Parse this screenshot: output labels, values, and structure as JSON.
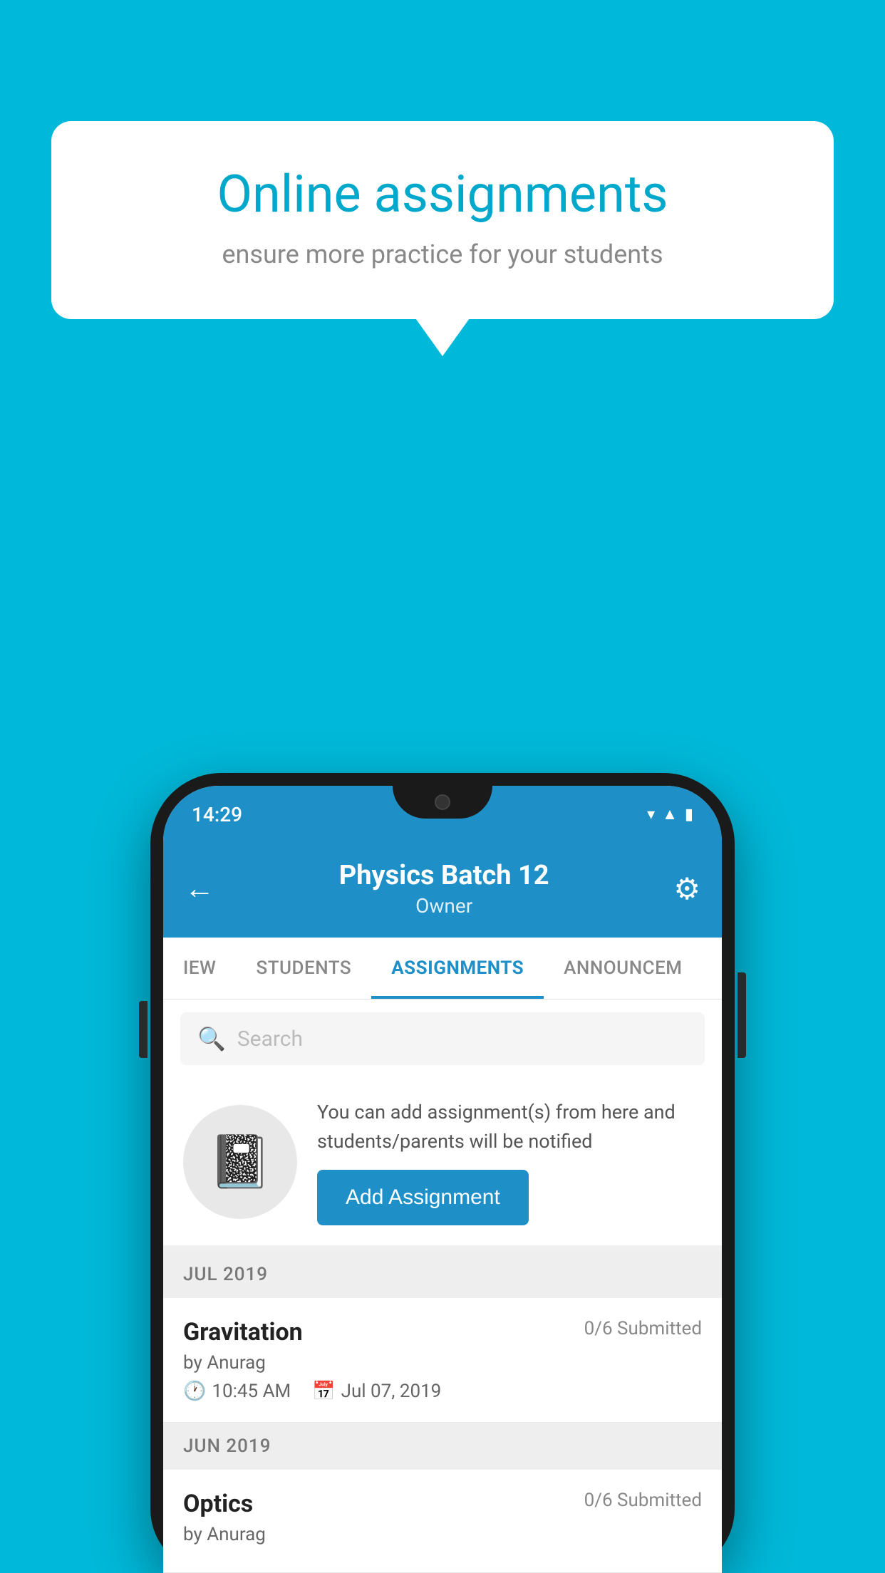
{
  "background_color": "#00B8D9",
  "speech_bubble": {
    "title": "Online assignments",
    "subtitle": "ensure more practice for your students"
  },
  "phone": {
    "status_bar": {
      "time": "14:29",
      "icons": [
        "wifi",
        "signal",
        "battery"
      ]
    },
    "header": {
      "title": "Physics Batch 12",
      "subtitle": "Owner",
      "back_label": "←",
      "settings_label": "⚙"
    },
    "tabs": [
      {
        "label": "IEW",
        "active": false
      },
      {
        "label": "STUDENTS",
        "active": false
      },
      {
        "label": "ASSIGNMENTS",
        "active": true
      },
      {
        "label": "ANNOUNCEM",
        "active": false
      }
    ],
    "search": {
      "placeholder": "Search"
    },
    "promo": {
      "description": "You can add assignment(s) from here and students/parents will be notified",
      "button_label": "Add Assignment"
    },
    "sections": [
      {
        "month_label": "JUL 2019",
        "assignments": [
          {
            "name": "Gravitation",
            "submitted": "0/6 Submitted",
            "by": "by Anurag",
            "time": "10:45 AM",
            "date": "Jul 07, 2019"
          }
        ]
      },
      {
        "month_label": "JUN 2019",
        "assignments": [
          {
            "name": "Optics",
            "submitted": "0/6 Submitted",
            "by": "by Anurag",
            "time": "",
            "date": ""
          }
        ]
      }
    ]
  }
}
